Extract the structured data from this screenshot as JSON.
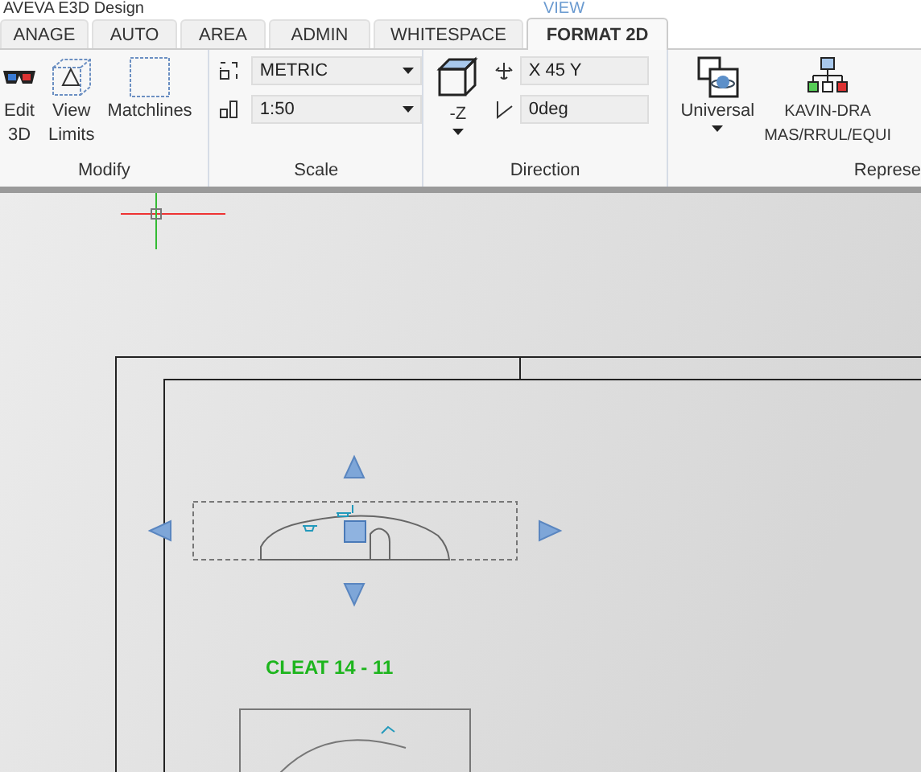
{
  "window": {
    "title": "AVEVA E3D Design",
    "context_label": "VIEW"
  },
  "tabs": [
    {
      "label": "ANAGE",
      "selected": false
    },
    {
      "label": "AUTO",
      "selected": false
    },
    {
      "label": "AREA",
      "selected": false
    },
    {
      "label": "ADMIN",
      "selected": false
    },
    {
      "label": "WHITESPACE",
      "selected": false
    },
    {
      "label": "FORMAT 2D",
      "selected": true
    }
  ],
  "modify": {
    "label": "Modify",
    "buttons": [
      {
        "lines": [
          "Edit",
          "3D"
        ]
      },
      {
        "lines": [
          "View",
          "Limits"
        ]
      },
      {
        "lines": [
          "Matchlines"
        ]
      }
    ]
  },
  "scale": {
    "label": "Scale",
    "dropdowns": [
      {
        "value": "METRIC"
      },
      {
        "value": "1:50"
      }
    ]
  },
  "direction": {
    "label": "Direction",
    "view_button": "-Z",
    "fields": [
      {
        "value": "X 45 Y"
      },
      {
        "value": "0deg"
      }
    ]
  },
  "representation": {
    "label": "Represe",
    "buttons": [
      {
        "lines": [
          "Universal"
        ]
      },
      {
        "lines": [
          "KAVIN-DRA",
          "MAS/RRUL/EQUI"
        ]
      }
    ]
  },
  "canvas": {
    "label": "CLEAT 14 - 11"
  }
}
